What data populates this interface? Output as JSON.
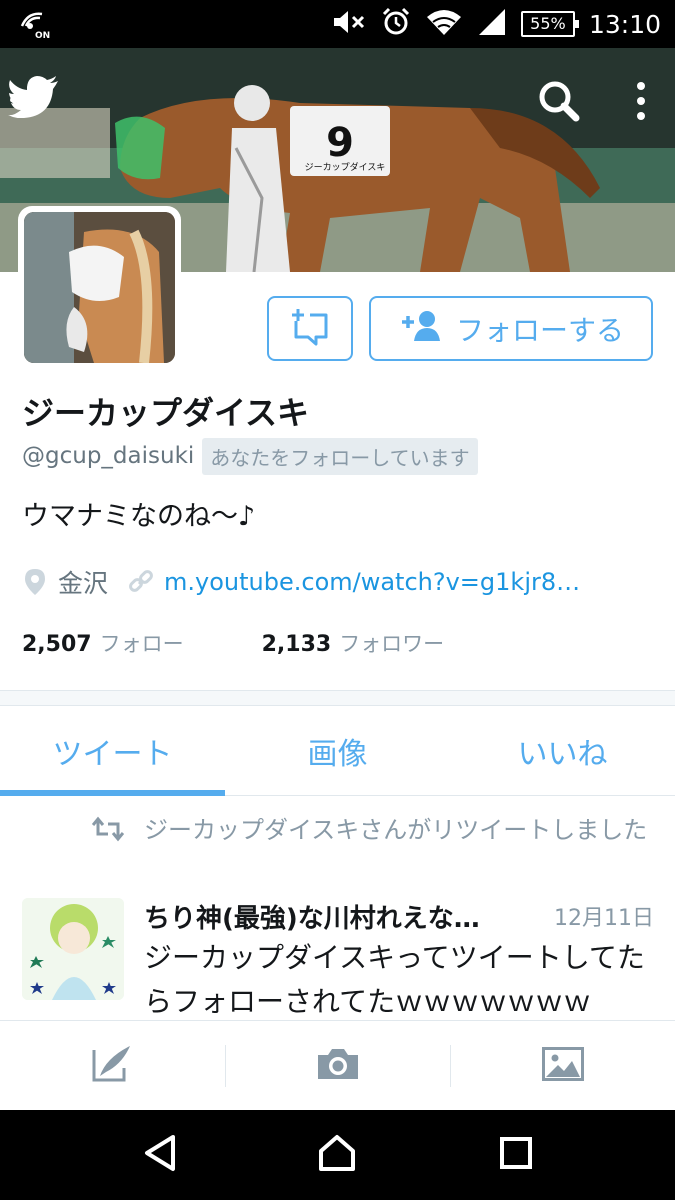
{
  "status_bar": {
    "nfc_icon": "nfc-on-icon",
    "nfc_label": "ON",
    "icons": [
      "mute-icon",
      "alarm-icon",
      "wifi-icon",
      "signal-icon"
    ],
    "battery": "55%",
    "time": "13:10"
  },
  "header": {
    "back_icon": "chevron-left-icon",
    "logo_icon": "twitter-bird-icon",
    "search_icon": "search-icon",
    "more_icon": "more-vertical-icon",
    "banner_bib_number": "9",
    "banner_bib_text": "ジーカップダイスキ"
  },
  "profile": {
    "display_name": "ジーカップダイスキ",
    "handle": "@gcup_daisuki",
    "follows_you": "あなたをフォローしています",
    "bio": "ウマナミなのね〜♪",
    "location": "金沢",
    "url": "m.youtube.com/watch?v=g1kjr8…",
    "following_count": "2,507",
    "following_label": "フォロー",
    "followers_count": "2,133",
    "followers_label": "フォロワー",
    "follow_button": "フォローする"
  },
  "tabs": [
    {
      "label": "ツイート",
      "active": true
    },
    {
      "label": "画像",
      "active": false
    },
    {
      "label": "いいね",
      "active": false
    }
  ],
  "tweet": {
    "retweet_notice": "ジーカップダイスキさんがリツイートしました",
    "author": "ちり神(最強)な川村れえな…",
    "date": "12月11日",
    "text": "ジーカップダイスキってツイートしてたらフォローされてたｗｗｗｗｗｗｗ"
  },
  "compose_bar": {
    "icons": [
      "compose-tweet-icon",
      "camera-icon",
      "image-icon"
    ]
  },
  "colors": {
    "accent": "#55acee",
    "link": "#1b95e0",
    "muted": "#8899a6",
    "text": "#14171a"
  }
}
